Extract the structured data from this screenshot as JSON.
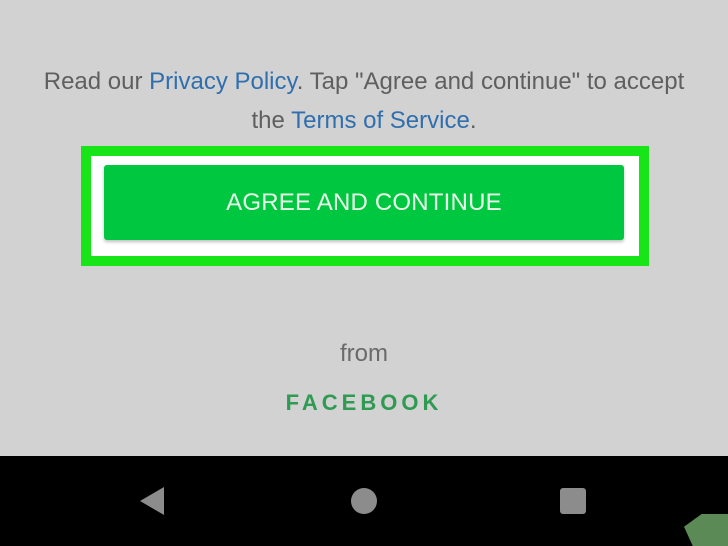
{
  "terms": {
    "before_privacy": "Read our ",
    "privacy_link": "Privacy Policy",
    "middle": ". Tap \"Agree and continue\" to accept the ",
    "terms_link": "Terms of Service",
    "end": "."
  },
  "agree_button": {
    "label": "AGREE AND CONTINUE"
  },
  "footer": {
    "from": "from",
    "brand": "FACEBOOK"
  },
  "navbar": {
    "back_icon": "back-triangle-icon",
    "home_icon": "home-circle-icon",
    "recents_icon": "recents-square-icon"
  },
  "colors": {
    "background": "#d2d2d2",
    "button": "#00c740",
    "highlight": "#18e518",
    "link": "#2f6fae",
    "brand": "#2f9a52"
  }
}
